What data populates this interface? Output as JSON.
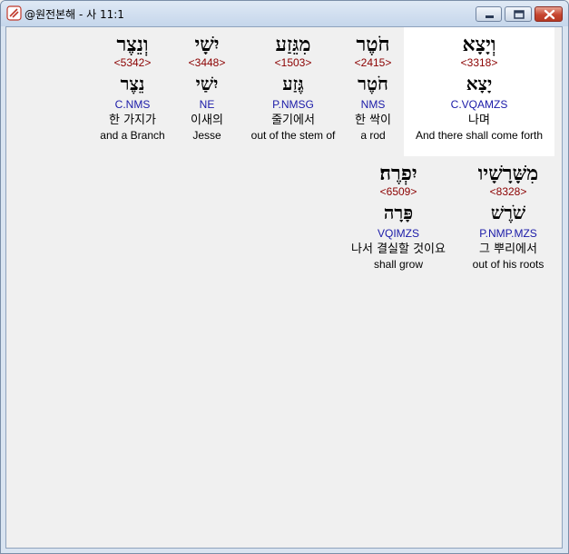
{
  "window": {
    "title": "@원전본해 - 사 11:1"
  },
  "words": [
    {
      "hebrew": "וְיָצָא",
      "strongs": "<3318>",
      "lemma": "יָצָא",
      "morph": "C.VQAMZS",
      "korean": "나며",
      "english": "And there shall come forth",
      "highlighted": true
    },
    {
      "hebrew": "חֹטֶר",
      "strongs": "<2415>",
      "lemma": "חֹטֶר",
      "morph": "NMS",
      "korean": "한 싹이",
      "english": "a rod"
    },
    {
      "hebrew": "מִגֵּזַע",
      "strongs": "<1503>",
      "lemma": "גֶּזַע",
      "morph": "P.NMSG",
      "korean": "줄기에서",
      "english": "out of the stem of"
    },
    {
      "hebrew": "יִשָׁי",
      "strongs": "<3448>",
      "lemma": "יִשַׁי",
      "morph": "NE",
      "korean": "이새의",
      "english": "Jesse"
    },
    {
      "hebrew": "וְנֵצֶר",
      "strongs": "<5342>",
      "lemma": "נֵצֶר",
      "morph": "C.NMS",
      "korean": "한 가지가",
      "english": "and a Branch"
    },
    {
      "hebrew": "מִשָּׁרָשָׁיו",
      "strongs": "<8328>",
      "lemma": "שֹׁרֶשׁ",
      "morph": "P.NMP.MZS",
      "korean": "그 뿌리에서",
      "english": "out of his roots"
    },
    {
      "hebrew": "יִפְרֶה׃",
      "strongs": "<6509>",
      "lemma": "פָּרָה",
      "morph": "VQIMZS",
      "korean": "나서 결실할 것이요",
      "english": "shall grow"
    }
  ]
}
